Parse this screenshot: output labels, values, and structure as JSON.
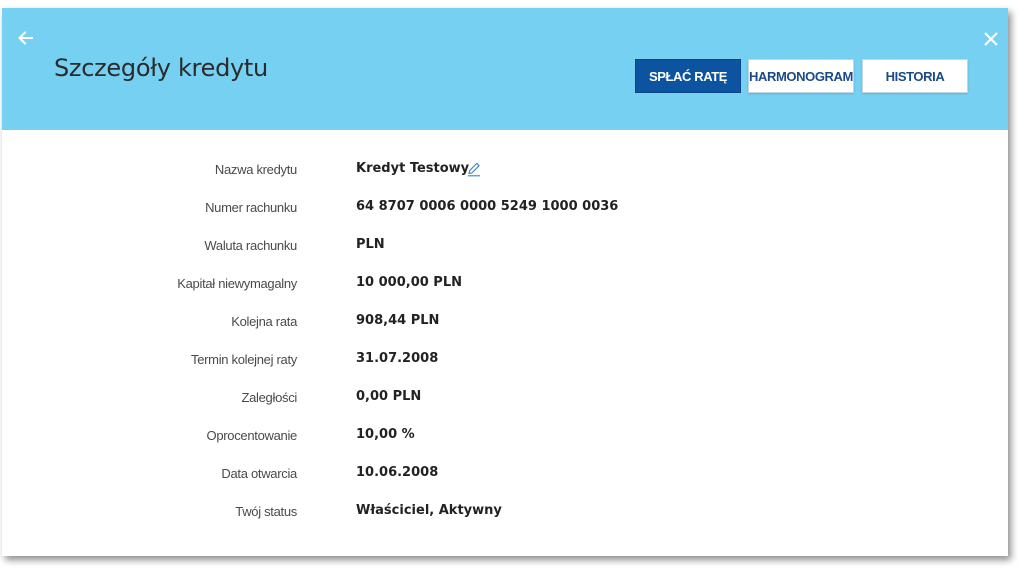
{
  "header": {
    "title": "Szczegóły kredytu",
    "back_icon": "arrow-left-icon",
    "close_icon": "close-icon",
    "background_color": "#75d0f2"
  },
  "actions": {
    "repay_label": "SPŁAĆ RATĘ",
    "schedule_label": "HARMONOGRAM",
    "history_label": "HISTORIA",
    "primary_color": "#0d54a0"
  },
  "details": {
    "name_label": "Nazwa kredytu",
    "name_value": "Kredyt Testowy",
    "edit_icon": "pencil-icon",
    "account_number_label": "Numer rachunku",
    "account_number_value": "64 8707 0006 0000 5249 1000 0036",
    "currency_label": "Waluta rachunku",
    "currency_value": "PLN",
    "capital_label": "Kapitał niewymagalny",
    "capital_value": "10 000,00  PLN",
    "next_installment_label": "Kolejna rata",
    "next_installment_value": "908,44  PLN",
    "next_installment_date_label": "Termin kolejnej raty",
    "next_installment_date_value": "31.07.2008",
    "arrears_label": "Zaległości",
    "arrears_value": "0,00  PLN",
    "interest_label": "Oprocentowanie",
    "interest_value": "10,00 %",
    "opening_date_label": "Data otwarcia",
    "opening_date_value": "10.06.2008",
    "status_label": "Twój status",
    "status_value": "Właściciel, Aktywny"
  }
}
